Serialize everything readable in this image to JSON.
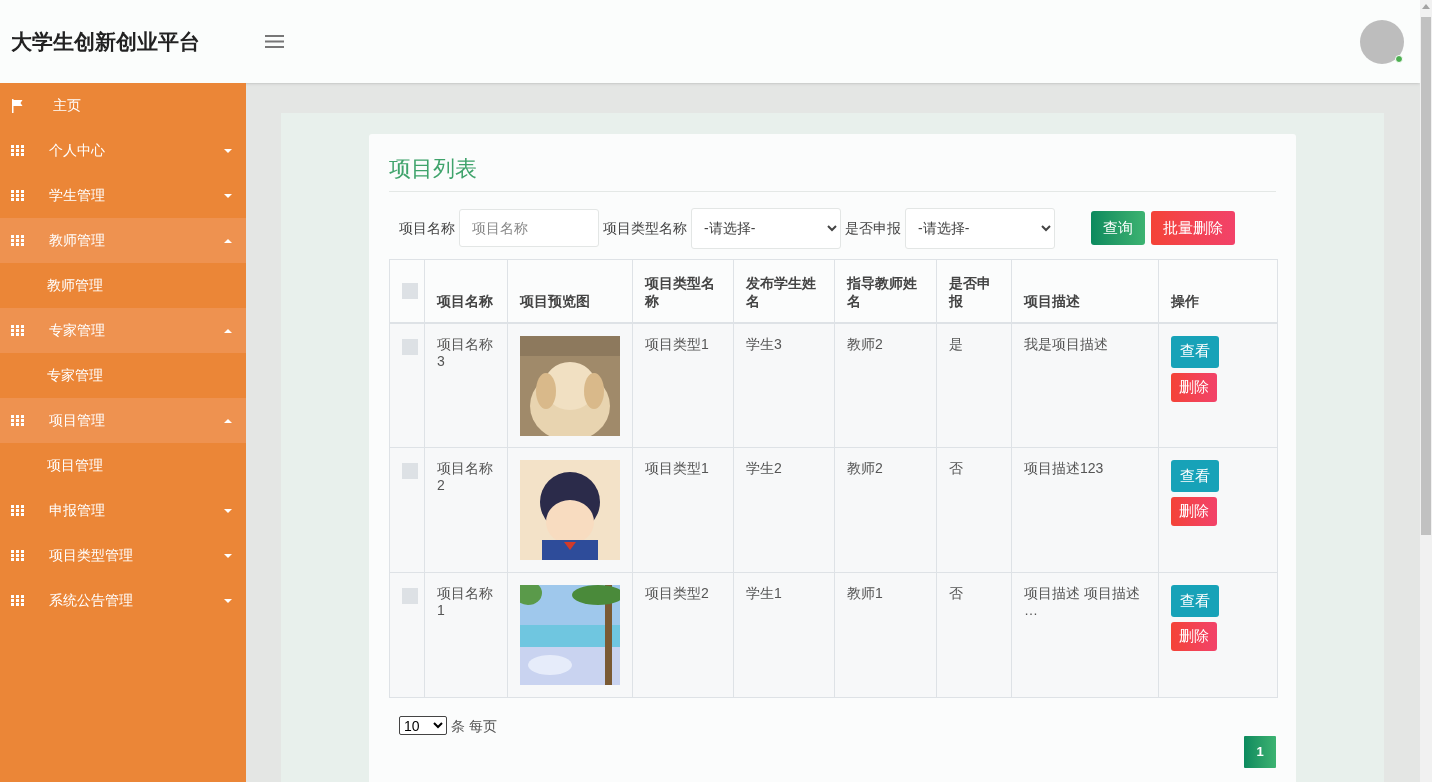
{
  "header": {
    "title": "大学生创新创业平台"
  },
  "sidebar": {
    "items": [
      {
        "kind": "link",
        "label": "主页"
      },
      {
        "kind": "group",
        "label": "个人中心",
        "expanded": false
      },
      {
        "kind": "group",
        "label": "学生管理",
        "expanded": false
      },
      {
        "kind": "group",
        "label": "教师管理",
        "expanded": true,
        "children": [
          {
            "label": "教师管理"
          }
        ]
      },
      {
        "kind": "group",
        "label": "专家管理",
        "expanded": true,
        "children": [
          {
            "label": "专家管理"
          }
        ]
      },
      {
        "kind": "group",
        "label": "项目管理",
        "expanded": true,
        "children": [
          {
            "label": "项目管理"
          }
        ]
      },
      {
        "kind": "group",
        "label": "申报管理",
        "expanded": false
      },
      {
        "kind": "group",
        "label": "项目类型管理",
        "expanded": false
      },
      {
        "kind": "group",
        "label": "系统公告管理",
        "expanded": false
      }
    ]
  },
  "card": {
    "title": "项目列表"
  },
  "filters": [
    {
      "kind": "input",
      "label": "项目名称",
      "placeholder": "项目名称"
    },
    {
      "kind": "select",
      "label": "项目类型名称",
      "value": "-请选择-"
    },
    {
      "kind": "select",
      "label": "是否申报",
      "value": "-请选择-"
    }
  ],
  "buttons": {
    "search": "查询",
    "batch_delete": "批量删除"
  },
  "table": {
    "select_all": {
      "checked": false
    },
    "columns": [
      "项目名称",
      "项目预览图",
      "项目类型名称",
      "发布学生姓名",
      "指导教师姓名",
      "是否申报",
      "项目描述",
      "操作"
    ],
    "rows": [
      {
        "checked": false,
        "name": "项目名称3",
        "picture": {
          "kind": "picture"
        },
        "type": "项目类型1",
        "student": "学生3",
        "teacher": "教师2",
        "declared": "是",
        "description": "我是项目描述",
        "actions": [
          "查看",
          "删除"
        ]
      },
      {
        "checked": false,
        "name": "项目名称2",
        "picture": {
          "kind": "picture"
        },
        "type": "项目类型1",
        "student": "学生2",
        "teacher": "教师2",
        "declared": "否",
        "description": "项目描述123",
        "actions": [
          "查看",
          "删除"
        ]
      },
      {
        "checked": false,
        "name": "项目名称1",
        "picture": {
          "kind": "picture"
        },
        "type": "项目类型2",
        "student": "学生1",
        "teacher": "教师1",
        "declared": "否",
        "description": "项目描述 项目描述 …",
        "actions": [
          "查看",
          "删除"
        ]
      }
    ]
  },
  "pagination": {
    "page_size": "10",
    "page_size_label": "条 每页",
    "pages": [
      {
        "label": "1",
        "selected": true
      }
    ]
  }
}
